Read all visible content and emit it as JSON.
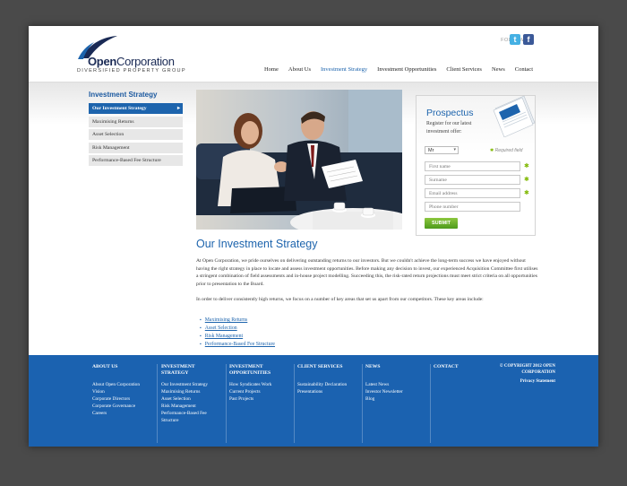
{
  "brand": {
    "name_part1": "Open",
    "name_part2": "Corporation",
    "tagline": "DIVERSIFIED PROPERTY GROUP",
    "logo_color": "#1a2a55",
    "accent": "#1d64ad"
  },
  "header": {
    "follow_label": "FOLLOW US",
    "social": [
      {
        "name": "twitter-icon",
        "glyph": "t",
        "color": "#45b0e3"
      },
      {
        "name": "facebook-icon",
        "glyph": "f",
        "color": "#3b5998"
      }
    ],
    "nav": [
      {
        "label": "Home",
        "active": false
      },
      {
        "label": "About Us",
        "active": false
      },
      {
        "label": "Investment Strategy",
        "active": true
      },
      {
        "label": "Investment Opportunities",
        "active": false
      },
      {
        "label": "Client Services",
        "active": false
      },
      {
        "label": "News",
        "active": false
      },
      {
        "label": "Contact",
        "active": false
      }
    ]
  },
  "sidebar": {
    "title": "Investment Strategy",
    "items": [
      {
        "label": "Our Investment Strategy",
        "active": true
      },
      {
        "label": "Maximising Returns",
        "active": false
      },
      {
        "label": "Asset Selection",
        "active": false
      },
      {
        "label": "Risk Management",
        "active": false
      },
      {
        "label": "Performance-Based Fee Structure",
        "active": false
      }
    ],
    "active_arrow": "▸"
  },
  "prospectus": {
    "title": "Prospectus",
    "text": "Register for our latest investment offer:",
    "title_select": "Mr",
    "required_label": "Required field",
    "fields": [
      {
        "placeholder": "First name",
        "required": true
      },
      {
        "placeholder": "Surname",
        "required": true
      },
      {
        "placeholder": "Email address",
        "required": true
      },
      {
        "placeholder": "Phone number",
        "required": false
      }
    ],
    "submit": "SUBMIT"
  },
  "main": {
    "heading": "Our Investment Strategy",
    "para1": "At Open Corporation, we pride ourselves on delivering outstanding returns to our investors. But we couldn't achieve the long-term success we have enjoyed without having the right strategy in place to locate and assess investment opportunities. Before making any decision to invest, our experienced Acquisition Committee first utilises a stringent combination of field assessments and in-house project modelling. Succeeding this, the risk-rated return projections must meet strict criteria on all opportunities prior to presentation to the Board.",
    "para2": "In order to deliver consistently high returns, we focus on a number of key areas that set us apart from our competitors. These key areas include:",
    "bullets": [
      "Maximising Returns",
      "Asset Selection",
      "Risk Management",
      "Performance-Based Fee Structure"
    ]
  },
  "footer": {
    "columns": [
      {
        "heading": "ABOUT US",
        "links": [
          "About Open Corporation",
          "Vision",
          "Corporate Directors",
          "Corporate Governance",
          "Careers"
        ]
      },
      {
        "heading": "INVESTMENT STRATEGY",
        "links": [
          "Our Investment Strategy",
          "Maximising Returns",
          "Asset Selection",
          "Risk Management",
          "Performance-Based Fee Structure"
        ]
      },
      {
        "heading": "INVESTMENT OPPORTUNITIES",
        "links": [
          "How Syndicates Work",
          "Current Projects",
          "Past Projects"
        ]
      },
      {
        "heading": "CLIENT SERVICES",
        "links": [
          "Sustainability Declaration",
          "Presentations"
        ]
      },
      {
        "heading": "NEWS",
        "links": [
          "Latest News",
          "Investor Newsletter",
          "Blog"
        ]
      },
      {
        "heading": "CONTACT",
        "links": []
      }
    ],
    "copyright": "© COPYRIGHT 2012 OPEN CORPORATION",
    "privacy": "Privacy Statement",
    "background": "#1b62b0"
  }
}
